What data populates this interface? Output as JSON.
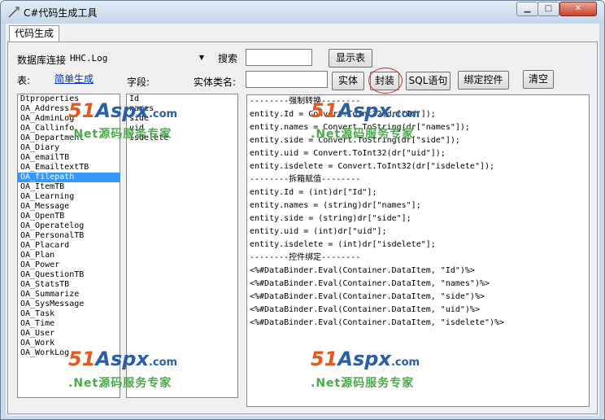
{
  "window": {
    "title": "C#代码生成工具"
  },
  "tabs": [
    {
      "label": "代码生成"
    }
  ],
  "form": {
    "db_label": "数据库连接",
    "db_value": "HHC.Log",
    "search_label": "搜索",
    "search_value": "",
    "show_tables_label": "显示表",
    "table_label": "表:",
    "simple_gen_link": "简单生成",
    "fields_label": "字段:",
    "entity_label": "实体类名:",
    "entity_value": "",
    "buttons": {
      "entity": "实体",
      "encapsulate": "封装",
      "sql": "SQL语句",
      "bind": "绑定控件",
      "clear": "清空"
    }
  },
  "tables": [
    "Dtproperties",
    "OA_Address",
    "OA_AdminLog",
    "OA_Callinfo",
    "OA_Department",
    "OA_Diary",
    "OA_emailTB",
    "OA_EmailtextTB",
    "OA_filepath",
    "OA_ItemTB",
    "OA_Learning",
    "OA_Message",
    "OA_OpenTB",
    "OA_Operatelog",
    "OA_PersonalTB",
    "OA_Placard",
    "OA_Plan",
    "OA_Power",
    "OA_QuestionTB",
    "OA_StatsTB",
    "OA_Summarize",
    "OA_SysMessage",
    "OA_Task",
    "OA_Time",
    "OA_User",
    "OA_Work",
    "OA_WorkLog"
  ],
  "selected_table": "OA_filepath",
  "fields": [
    "Id",
    "names",
    "side",
    "uid",
    "isdelete"
  ],
  "output_lines": [
    "--------强制转换--------",
    "entity.Id = Convert.ToInt32(dr[\"Id\"]);",
    "entity.names = Convert.ToString(dr[\"names\"]);",
    "entity.side = Convert.ToString(dr[\"side\"]);",
    "entity.uid = Convert.ToInt32(dr[\"uid\"]);",
    "entity.isdelete = Convert.ToInt32(dr[\"isdelete\"]);",
    "--------拆箱赋值--------",
    "entity.Id = (int)dr[\"Id\"];",
    "entity.names = (string)dr[\"names\"];",
    "entity.side = (string)dr[\"side\"];",
    "entity.uid = (int)dr[\"uid\"];",
    "entity.isdelete = (int)dr[\"isdelete\"];",
    "--------控件绑定--------",
    "<%#DataBinder.Eval(Container.DataItem, \"Id\")%>",
    "<%#DataBinder.Eval(Container.DataItem, \"names\")%>",
    "<%#DataBinder.Eval(Container.DataItem, \"side\")%>",
    "<%#DataBinder.Eval(Container.DataItem, \"uid\")%>",
    "<%#DataBinder.Eval(Container.DataItem, \"isdelete\")%>"
  ],
  "watermark": {
    "brand_num": "51",
    "brand_word": "Aspx",
    "brand_tld": ".com",
    "slogan": ".Net源码服务专家"
  },
  "colors": {
    "selection": "#3399ff",
    "link": "#0033cc",
    "watermark_orange": "#e35a1c",
    "watermark_blue": "#2a5fa8",
    "watermark_green": "#4fa84f"
  }
}
